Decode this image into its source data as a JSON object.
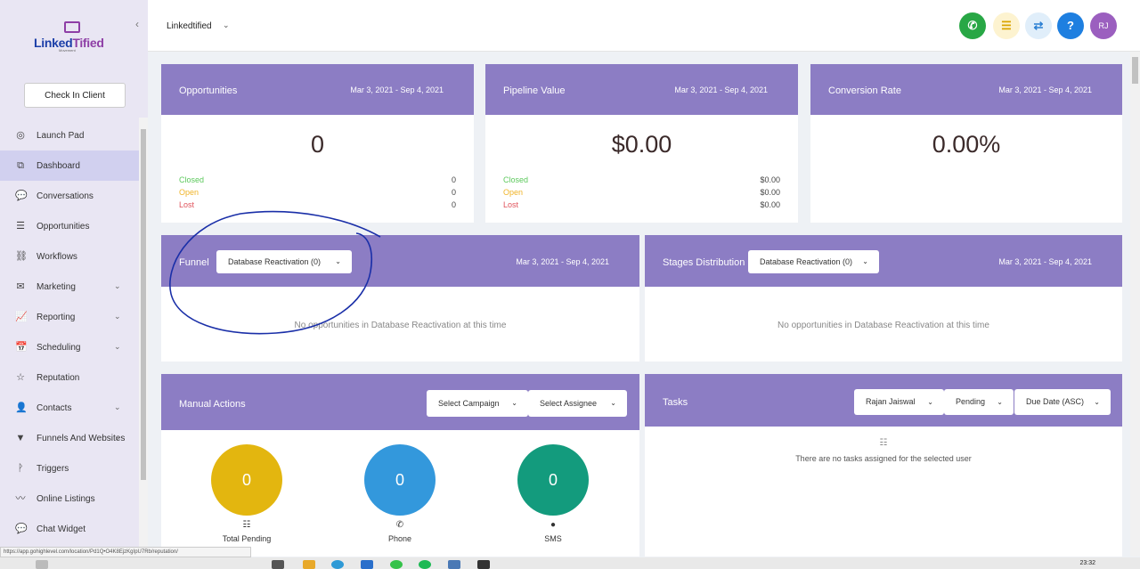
{
  "sidebar": {
    "logo_main": "Linked",
    "logo_accent": "Tified",
    "logo_sub": "Movement",
    "checkin_label": "Check In Client",
    "items": [
      {
        "label": "Launch Pad",
        "icon": "globe-icon",
        "glyph": "◎",
        "chev": false
      },
      {
        "label": "Dashboard",
        "icon": "dashboard-icon",
        "glyph": "⧉",
        "chev": false,
        "active": true
      },
      {
        "label": "Conversations",
        "icon": "chat-icon",
        "glyph": "💬",
        "chev": false
      },
      {
        "label": "Opportunities",
        "icon": "layers-icon",
        "glyph": "☰",
        "chev": false
      },
      {
        "label": "Workflows",
        "icon": "workflow-icon",
        "glyph": "⛓",
        "chev": false
      },
      {
        "label": "Marketing",
        "icon": "mail-icon",
        "glyph": "✉",
        "chev": true
      },
      {
        "label": "Reporting",
        "icon": "chart-icon",
        "glyph": "📈",
        "chev": true
      },
      {
        "label": "Scheduling",
        "icon": "calendar-icon",
        "glyph": "📅",
        "chev": true
      },
      {
        "label": "Reputation",
        "icon": "star-icon",
        "glyph": "☆",
        "chev": false
      },
      {
        "label": "Contacts",
        "icon": "user-icon",
        "glyph": "👤",
        "chev": true
      },
      {
        "label": "Funnels And Websites",
        "icon": "funnel-icon",
        "glyph": "▼",
        "chev": true
      },
      {
        "label": "Triggers",
        "icon": "trigger-icon",
        "glyph": "ᚹ",
        "chev": false
      },
      {
        "label": "Online Listings",
        "icon": "pulse-icon",
        "glyph": "〰",
        "chev": false
      },
      {
        "label": "Chat Widget",
        "icon": "chat-widget-icon",
        "glyph": "💬",
        "chev": false
      }
    ]
  },
  "header": {
    "location": "Linkedtified",
    "user_initials": "RJ",
    "help": "?"
  },
  "opportunities_card": {
    "title": "Opportunities",
    "date_range": "Mar 3, 2021 - Sep 4, 2021",
    "total": "0",
    "closed_label": "Closed",
    "closed_value": "0",
    "open_label": "Open",
    "open_value": "0",
    "lost_label": "Lost",
    "lost_value": "0"
  },
  "pipeline_card": {
    "title": "Pipeline Value",
    "date_range": "Mar 3, 2021 - Sep 4, 2021",
    "total": "$0.00",
    "closed_label": "Closed",
    "closed_value": "$0.00",
    "open_label": "Open",
    "open_value": "$0.00",
    "lost_label": "Lost",
    "lost_value": "$0.00"
  },
  "conversion_card": {
    "title": "Conversion Rate",
    "date_range": "Mar 3, 2021 - Sep 4, 2021",
    "total": "0.00%"
  },
  "funnel_card": {
    "title": "Funnel",
    "select": "Database Reactivation (0)",
    "date_range": "Mar 3, 2021 - Sep 4, 2021",
    "empty": "No opportunities in Database Reactivation at this time"
  },
  "stages_card": {
    "title": "Stages Distribution",
    "select": "Database Reactivation (0)",
    "date_range": "Mar 3, 2021 - Sep 4, 2021",
    "empty": "No opportunities in Database Reactivation at this time"
  },
  "manual_actions": {
    "title": "Manual Actions",
    "campaign_select": "Select Campaign",
    "assignee_select": "Select Assignee",
    "total_pending": "0",
    "total_pending_label": "Total Pending",
    "phone": "0",
    "phone_label": "Phone",
    "sms": "0",
    "sms_label": "SMS"
  },
  "tasks": {
    "title": "Tasks",
    "user_select": "Rajan Jaiswal",
    "status_select": "Pending",
    "sort_select": "Due Date (ASC)",
    "empty": "There are no tasks assigned for the selected user"
  },
  "status_url": "https://app.gohighlevel.com/location/Pd1Q•O4K8EjzKgIpU7Rb/reputation/",
  "clock": "23:32",
  "colors": {
    "purple_header": "#8c7dc4",
    "closed": "#5cc95c",
    "open": "#f0b429",
    "lost": "#e0535b",
    "yellow_circle": "#e3b60f",
    "blue_circle": "#3398dc",
    "green_circle": "#139b7d"
  }
}
